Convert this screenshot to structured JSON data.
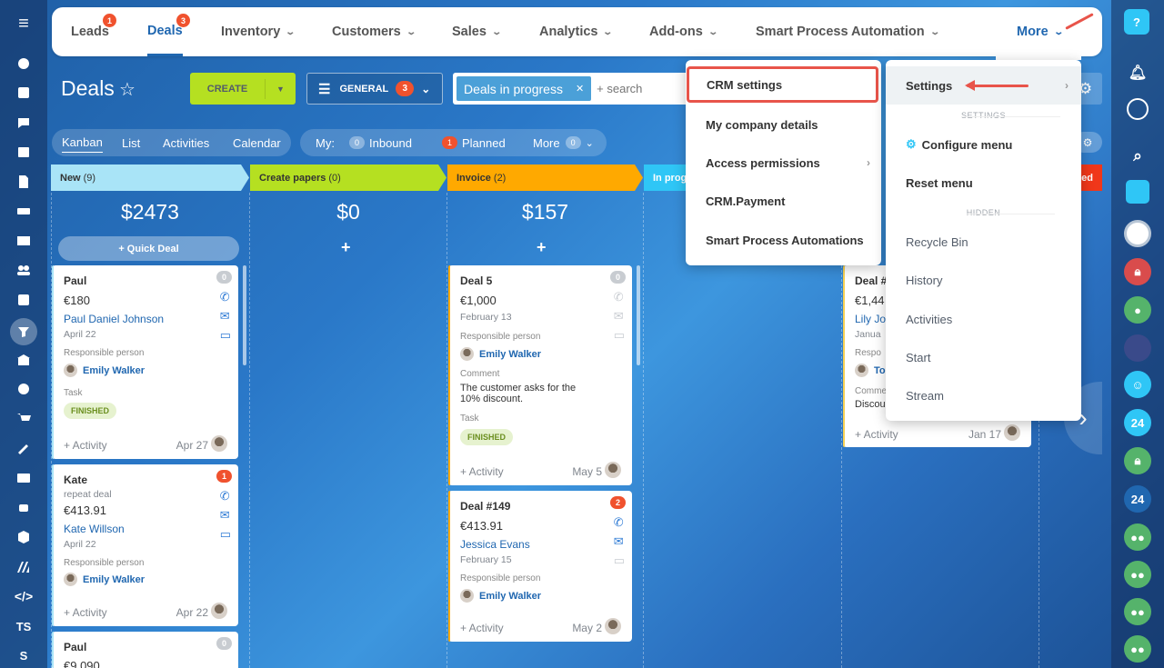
{
  "colors": {
    "accent": "#2067b0",
    "create": "#b5e021",
    "badge": "#f0522e",
    "arrow": "#e8544a"
  },
  "nav": {
    "items": [
      {
        "label": "Leads",
        "badge": "1",
        "active": false
      },
      {
        "label": "Deals",
        "badge": "3",
        "active": true
      },
      {
        "label": "Inventory"
      },
      {
        "label": "Customers"
      },
      {
        "label": "Sales"
      },
      {
        "label": "Analytics"
      },
      {
        "label": "Add-ons"
      },
      {
        "label": "Smart Process Automation"
      },
      {
        "label": "More"
      }
    ]
  },
  "toolbar": {
    "title": "Deals",
    "create": "CREATE",
    "general": "GENERAL",
    "general_count": "3",
    "filter_tag": "Deals in progress",
    "search_placeholder": "+ search"
  },
  "views": {
    "tabs": [
      "Kanban",
      "List",
      "Activities",
      "Calendar"
    ],
    "active": "Kanban",
    "my_label": "My:",
    "inbound_count": "0",
    "inbound": "Inbound",
    "planned_count": "1",
    "planned": "Planned",
    "more": "More",
    "more_count": "0"
  },
  "stages": [
    {
      "name": "New",
      "count": "(9)",
      "color": "#a9e4f7",
      "total": "$2473"
    },
    {
      "name": "Create papers",
      "count": "(0)",
      "color": "#b5e021",
      "total": "$0"
    },
    {
      "name": "Invoice",
      "count": "(2)",
      "color": "#ffa900",
      "total": "$157"
    },
    {
      "name": "In prog",
      "count": "",
      "color": "#2fc6f6",
      "total": ""
    },
    {
      "name": "iled",
      "count": "",
      "color": "#f0371a",
      "total": ""
    }
  ],
  "quick_deal": "+ Quick Deal",
  "cards": {
    "paul": {
      "title": "Paul",
      "price": "€180",
      "contact": "Paul Daniel Johnson",
      "date": "April 22",
      "resp_label": "Responsible person",
      "resp": "Emily Walker",
      "task_label": "Task",
      "status": "FINISHED",
      "activity": "+ Activity",
      "adate": "Apr 27",
      "badge": "0"
    },
    "kate": {
      "title": "Kate",
      "sub": "repeat deal",
      "price": "€413.91",
      "contact": "Kate Willson",
      "date": "April 22",
      "resp_label": "Responsible person",
      "resp": "Emily Walker",
      "activity": "+ Activity",
      "adate": "Apr 22",
      "badge": "1"
    },
    "paul2": {
      "title": "Paul",
      "price": "€9,090",
      "badge": "0"
    },
    "deal5": {
      "title": "Deal 5",
      "price": "€1,000",
      "date": "February 13",
      "resp_label": "Responsible person",
      "resp": "Emily Walker",
      "comment_label": "Comment",
      "comment": "The customer asks for the 10% discount.",
      "task_label": "Task",
      "status": "FINISHED",
      "activity": "+ Activity",
      "adate": "May 5",
      "badge": "0"
    },
    "deal149": {
      "title": "Deal #149",
      "price": "€413.91",
      "contact": "Jessica Evans",
      "date": "February 15",
      "resp_label": "Responsible person",
      "resp": "Emily Walker",
      "activity": "+ Activity",
      "adate": "May 2",
      "badge": "2"
    },
    "dealx": {
      "title": "Deal #",
      "price": "€1,44",
      "contact": "Lily Jo",
      "date": "Janua",
      "resp_label": "Respo",
      "resp": "To",
      "comment_label": "Comme",
      "comment": "Discou",
      "activity": "+ Activity",
      "adate": "Jan 17"
    }
  },
  "more_menu": {
    "items": [
      "CRM settings",
      "My company details",
      "Access permissions",
      "CRM.Payment",
      "Smart Process Automations"
    ]
  },
  "settings_menu": {
    "settings": "Settings",
    "sec1": "SETTINGS",
    "configure": "Configure menu",
    "reset": "Reset menu",
    "sec2": "HIDDEN",
    "hidden": [
      "Recycle Bin",
      "History",
      "Activities",
      "Start",
      "Stream"
    ]
  },
  "left_sidebar": {
    "ts": "TS",
    "s": "S"
  },
  "right_sidebar": {
    "n24": "24"
  }
}
